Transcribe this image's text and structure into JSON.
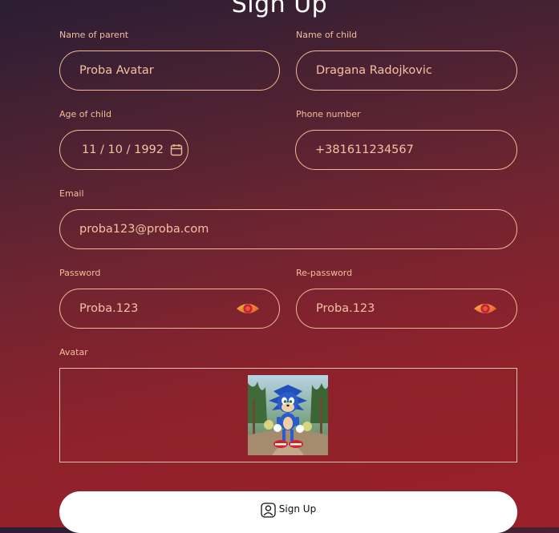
{
  "page": {
    "title": "Sign Up"
  },
  "form": {
    "parent_name": {
      "label": "Name of parent",
      "value": "Proba Avatar"
    },
    "child_name": {
      "label": "Name of child",
      "value": "Dragana Radojkovic"
    },
    "child_age": {
      "label": "Age of child",
      "value": "11 / 10 / 1992"
    },
    "phone": {
      "label": "Phone number",
      "value": "+381611234567"
    },
    "email": {
      "label": "Email",
      "value": "proba123@proba.com"
    },
    "password": {
      "label": "Password",
      "value": "Proba.123"
    },
    "repassword": {
      "label": "Re-password",
      "value": "Proba.123"
    },
    "avatar": {
      "label": "Avatar"
    }
  },
  "submit": {
    "label": "Sign Up",
    "icon": "user-icon"
  },
  "colors": {
    "field_border": "#f0b895",
    "text": "#f5c2a2",
    "eye_orange": "#f2a13b",
    "eye_red": "#c0223a"
  }
}
